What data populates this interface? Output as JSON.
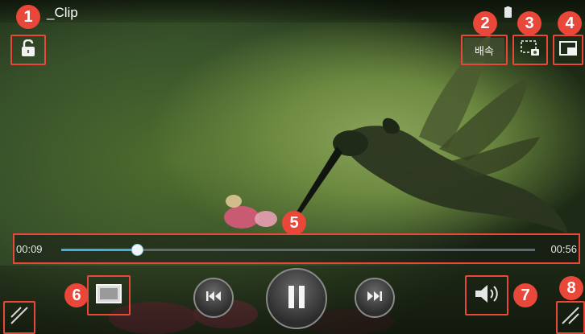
{
  "video": {
    "title": "_Clip",
    "current_time": "00:09",
    "total_time": "00:56",
    "progress": 0.16
  },
  "controls": {
    "lock_icon": "unlock-icon",
    "speed_label": "배속",
    "capture_icon": "capture-icon",
    "popup_icon": "popup-player-icon",
    "screen_mode_icon": "screen-mode-icon",
    "prev_icon": "rewind-icon",
    "play_pause_icon": "pause-icon",
    "next_icon": "fast-forward-icon",
    "volume_icon": "volume-icon"
  },
  "markers": [
    "1",
    "2",
    "3",
    "4",
    "5",
    "6",
    "7",
    "8"
  ],
  "colors": {
    "marker": "#e8473a",
    "progress_fill": "#3fb0e0"
  }
}
